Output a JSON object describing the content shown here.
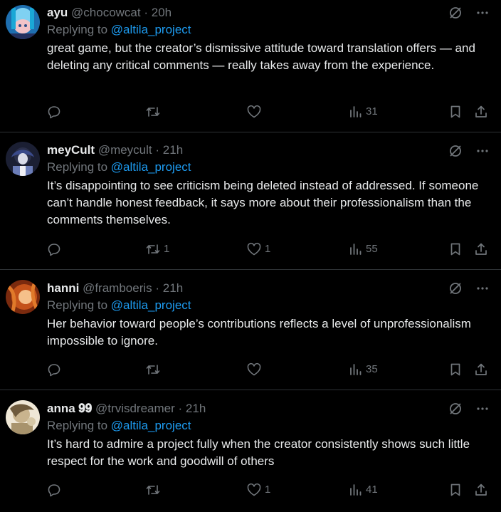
{
  "tweets": [
    {
      "name": "ayu",
      "handle": "@chocowcat",
      "separator": "·",
      "time": "20h",
      "replying_prefix": "Replying to",
      "replying_to": "@altila_project",
      "text": "great game, but the creator’s dismissive attitude toward translation offers — and deleting any critical comments — really takes away from the experience.",
      "replies": "",
      "retweets": "",
      "likes": "",
      "views": "31",
      "avatar_colors": [
        "#1e6fb0",
        "#7fd1f2",
        "#f2c3c8"
      ]
    },
    {
      "name": "meyCult",
      "handle": "@meycult",
      "separator": "·",
      "time": "21h",
      "replying_prefix": "Replying to",
      "replying_to": "@altila_project",
      "text": "It’s disappointing to see criticism being deleted instead of addressed. If someone can’t handle honest feedback, it says more about their professionalism than the comments themselves.",
      "replies": "",
      "retweets": "1",
      "likes": "1",
      "views": "55",
      "avatar_colors": [
        "#2a2f4a",
        "#6b7db8",
        "#d9dbe8"
      ]
    },
    {
      "name": "hanni",
      "handle": "@framboeris",
      "separator": "·",
      "time": "21h",
      "replying_prefix": "Replying to",
      "replying_to": "@altila_project",
      "text": "Her behavior toward people’s contributions reflects a level of unprofessionalism impossible to ignore.",
      "replies": "",
      "retweets": "",
      "likes": "",
      "views": "35",
      "avatar_colors": [
        "#7a2a0e",
        "#e07a2a",
        "#f5c08a"
      ]
    },
    {
      "name": "anna 𝟗𝟗",
      "handle": "@trvisdreamer",
      "separator": "·",
      "time": "21h",
      "replying_prefix": "Replying to",
      "replying_to": "@altila_project",
      "text": "It’s hard to admire a project fully when the creator consistently shows such little respect for the work and goodwill of others",
      "replies": "",
      "retweets": "",
      "likes": "1",
      "views": "41",
      "avatar_colors": [
        "#6e5a3c",
        "#c9b48e",
        "#efe7d6"
      ]
    }
  ],
  "colors": {
    "background": "#000000",
    "text": "#e7e9ea",
    "muted": "#71767b",
    "link": "#1d9bf0",
    "divider": "#2f3336"
  }
}
